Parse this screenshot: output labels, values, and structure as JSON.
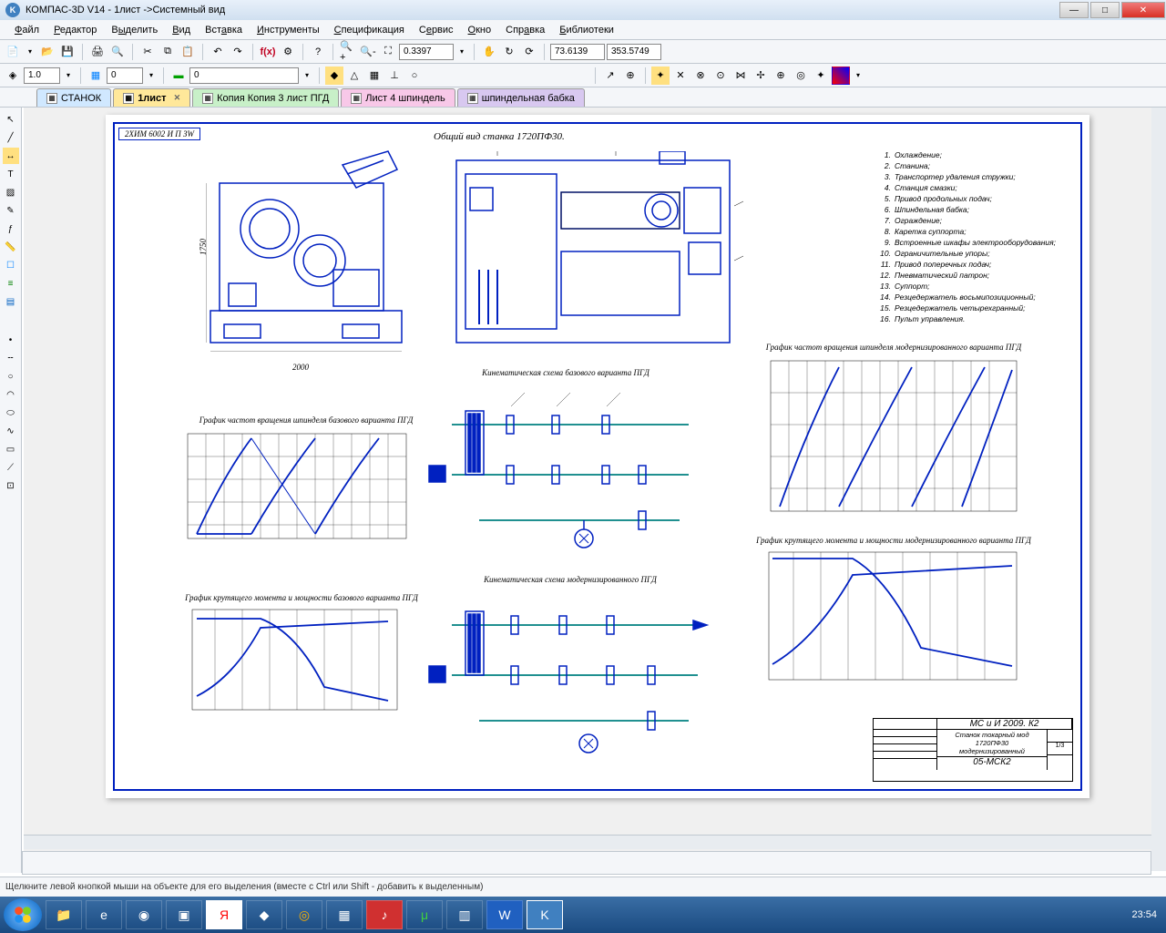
{
  "window": {
    "title": "КОМПАС-3D V14 - 1лист ->Системный вид"
  },
  "menu": {
    "items": [
      "Файл",
      "Редактор",
      "Выделить",
      "Вид",
      "Вставка",
      "Инструменты",
      "Спецификация",
      "Сервис",
      "Окно",
      "Справка",
      "Библиотеки"
    ]
  },
  "toolbar1": {
    "scale_val": "1.0",
    "layer_val": "0",
    "style_val": "0"
  },
  "toolbar2": {
    "zoom_val": "0.3397",
    "coord_x": "73.6139",
    "coord_y": "353.5749"
  },
  "tabs": [
    {
      "label": "СТАНОК",
      "cls": "tab-c0"
    },
    {
      "label": "1лист",
      "cls": "tab-c1",
      "closeable": true
    },
    {
      "label": "Копия Копия 3 лист ПГД",
      "cls": "tab-c2"
    },
    {
      "label": "Лист 4 шпиндель",
      "cls": "tab-c3"
    },
    {
      "label": "шпиндельная бабка",
      "cls": "tab-c4"
    }
  ],
  "drawing": {
    "corner_label": "2ХИМ 6002 И П ЗW",
    "main_title": "Общий вид станка 1720ПФ30.",
    "chart1_title": "График частот вращения шпинделя базового варианта ПГД",
    "chart2_title": "Кинематическая схема базового варианта ПГД",
    "chart3_title": "График крутящего момента и мощности базового варианта ПГД",
    "chart4_title": "Кинематическая схема модернизированного ПГД",
    "chart5_title": "График частот вращения шпинделя модернизированного варианта ПГД",
    "chart6_title": "График крутящего момента и мощности модернизированного варианта ПГД",
    "dim1": "2000",
    "dim2": "1750",
    "legend": [
      "Охлаждение;",
      "Станина;",
      "Транспортер удаления стружки;",
      "Станция смазки;",
      "Привод продольных подач;",
      "Шпиндельная бабка;",
      "Ограждение;",
      "Каретка суппорта;",
      "Встроенные шкафы электрооборудования;",
      "Ограничительные упоры;",
      "Привод поперечных подач;",
      "Пневматический патрон;",
      "Суппорт;",
      "Резцедержатель восьмипозиционный;",
      "Резцедержатель четырехгранный;",
      "Пульт управления."
    ],
    "titleblock": {
      "designation": "МС и И 2009. К2",
      "name1": "Станок токарный мод",
      "name2": "1720ПФ30",
      "name3": "модернизированный",
      "code": "05-МСК2",
      "sheet": "1/3"
    }
  },
  "status": {
    "text": "Щелкните левой кнопкой мыши на объекте для его выделения (вместе с Ctrl или Shift - добавить к выделенным)"
  },
  "clock": {
    "time": "23:54"
  }
}
